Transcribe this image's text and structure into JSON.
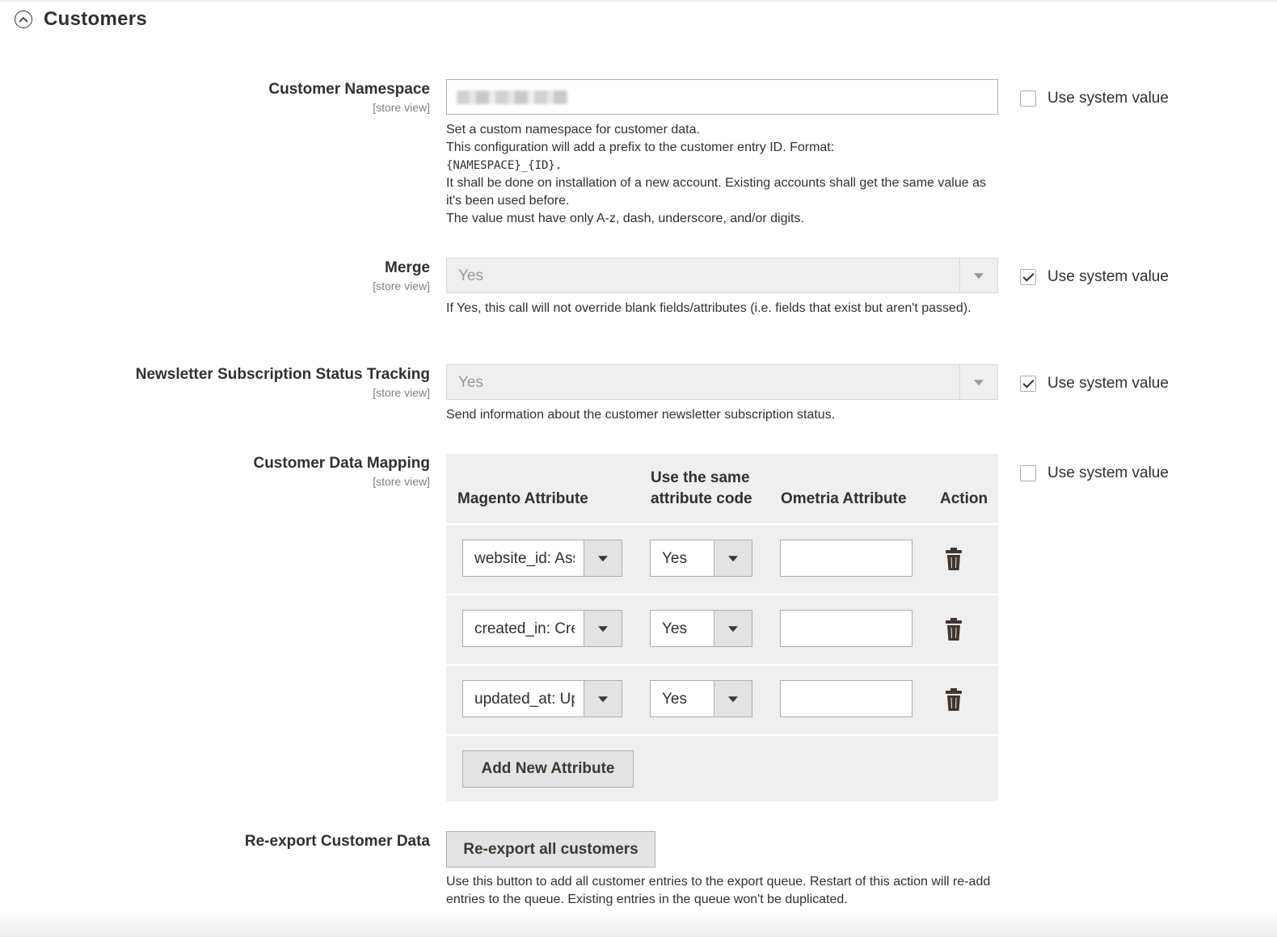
{
  "section": {
    "title": "Customers",
    "icon": "chevron-up-circle-icon"
  },
  "scope_label": "[store view]",
  "use_system_value_label": "Use system value",
  "fields": {
    "namespace": {
      "label": "Customer Namespace",
      "use_system_value": false,
      "notes": [
        "Set a custom namespace for customer data.",
        "This configuration will add a prefix to the customer entry ID. Format:",
        "{NAMESPACE}_{ID}.",
        "It shall be done on installation of a new account. Existing accounts shall get the same value as it's been used before.",
        "The value must have only A-z, dash, underscore, and/or digits."
      ]
    },
    "merge": {
      "label": "Merge",
      "value": "Yes",
      "use_system_value": true,
      "note": "If Yes, this call will not override blank fields/attributes (i.e. fields that exist but aren't passed)."
    },
    "newsletter": {
      "label": "Newsletter Subscription Status Tracking",
      "value": "Yes",
      "use_system_value": true,
      "note": "Send information about the customer newsletter subscription status."
    },
    "mapping": {
      "label": "Customer Data Mapping",
      "use_system_value": false,
      "columns": {
        "magento": "Magento Attribute",
        "same_line1": "Use the same",
        "same_line2": "attribute code",
        "ometria": "Ometria Attribute",
        "action": "Action"
      },
      "rows": [
        {
          "magento": "website_id: Associate to Website",
          "same": "Yes",
          "ometria": ""
        },
        {
          "magento": "created_in: Created From",
          "same": "Yes",
          "ometria": ""
        },
        {
          "magento": "updated_at: Updated At",
          "same": "Yes",
          "ometria": ""
        }
      ],
      "add_button": "Add New Attribute"
    },
    "reexport": {
      "label": "Re-export Customer Data",
      "button": "Re-export all customers",
      "note": "Use this button to add all customer entries to the export queue. Restart of this action will re-add entries to the queue. Existing entries in the queue won't be duplicated."
    }
  }
}
